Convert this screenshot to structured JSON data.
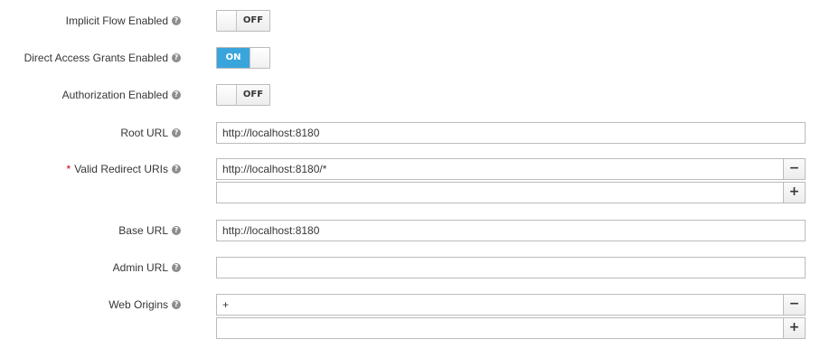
{
  "fields": {
    "implicit_flow": {
      "label": "Implicit Flow Enabled",
      "state": "OFF"
    },
    "direct_access": {
      "label": "Direct Access Grants Enabled",
      "state": "ON"
    },
    "authorization": {
      "label": "Authorization Enabled",
      "state": "OFF"
    },
    "root_url": {
      "label": "Root URL",
      "value": "http://localhost:8180"
    },
    "valid_redirect_uris": {
      "required_marker": "*",
      "label": "Valid Redirect URIs",
      "values": [
        "http://localhost:8180/*",
        ""
      ]
    },
    "base_url": {
      "label": "Base URL",
      "value": "http://localhost:8180"
    },
    "admin_url": {
      "label": "Admin URL",
      "value": ""
    },
    "web_origins": {
      "label": "Web Origins",
      "values": [
        "+",
        ""
      ]
    }
  },
  "buttons": {
    "remove_symbol": "−",
    "add_symbol": "+"
  },
  "icons": {
    "help": "question-circle-icon",
    "help_glyph": "?"
  },
  "colors": {
    "toggle_on": "#39a5dc",
    "required": "#cc0000"
  }
}
